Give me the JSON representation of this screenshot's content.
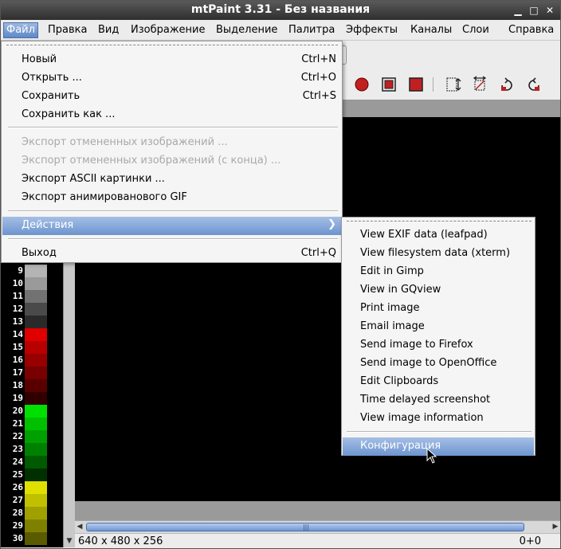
{
  "window": {
    "title": "mtPaint 3.31 - Без названия"
  },
  "menubar": [
    {
      "label": "Файл"
    },
    {
      "label": "Правка"
    },
    {
      "label": "Вид"
    },
    {
      "label": "Изображение"
    },
    {
      "label": "Выделение"
    },
    {
      "label": "Палитра"
    },
    {
      "label": "Эффекты"
    },
    {
      "label": "Каналы"
    },
    {
      "label": "Слои"
    },
    {
      "label": "Справка"
    }
  ],
  "file_menu": {
    "items": [
      {
        "label": "Новый",
        "accel": "Ctrl+N"
      },
      {
        "label": "Открыть ...",
        "accel": "Ctrl+O"
      },
      {
        "label": "Сохранить",
        "accel": "Ctrl+S"
      },
      {
        "label": "Сохранить как ..."
      },
      {
        "label": "Экспорт отмененных изображений ..."
      },
      {
        "label": "Экспорт отмененных изображений (с конца) ..."
      },
      {
        "label": "Экспорт ASCII картинки ..."
      },
      {
        "label": "Экспорт анимированового GIF"
      },
      {
        "label": "Действия"
      },
      {
        "label": "Выход",
        "accel": "Ctrl+Q"
      }
    ]
  },
  "actions_submenu": {
    "items": [
      {
        "label": "View EXIF data (leafpad)"
      },
      {
        "label": "View filesystem data (xterm)"
      },
      {
        "label": "Edit in Gimp"
      },
      {
        "label": "View in GQview"
      },
      {
        "label": "Print image"
      },
      {
        "label": "Email image"
      },
      {
        "label": "Send image to Firefox"
      },
      {
        "label": "Send image to OpenOffice"
      },
      {
        "label": "Edit Clipboards"
      },
      {
        "label": "Time delayed screenshot"
      },
      {
        "label": "View image information"
      },
      {
        "label": "Конфигурация"
      }
    ]
  },
  "palette": [
    {
      "index": "9",
      "color": "#b4b4b4"
    },
    {
      "index": "10",
      "color": "#9a9a9a"
    },
    {
      "index": "11",
      "color": "#727272"
    },
    {
      "index": "12",
      "color": "#4a4a4a"
    },
    {
      "index": "13",
      "color": "#2a2a2a"
    },
    {
      "index": "14",
      "color": "#e00000"
    },
    {
      "index": "15",
      "color": "#b80000"
    },
    {
      "index": "16",
      "color": "#980000"
    },
    {
      "index": "17",
      "color": "#780000"
    },
    {
      "index": "18",
      "color": "#580000"
    },
    {
      "index": "19",
      "color": "#300000"
    },
    {
      "index": "20",
      "color": "#00e000"
    },
    {
      "index": "21",
      "color": "#00c000"
    },
    {
      "index": "22",
      "color": "#00a000"
    },
    {
      "index": "23",
      "color": "#008000"
    },
    {
      "index": "24",
      "color": "#005a00"
    },
    {
      "index": "25",
      "color": "#003000"
    },
    {
      "index": "26",
      "color": "#e0e000"
    },
    {
      "index": "27",
      "color": "#c0c000"
    },
    {
      "index": "28",
      "color": "#a0a000"
    },
    {
      "index": "29",
      "color": "#808000"
    },
    {
      "index": "30",
      "color": "#5a5a00"
    }
  ],
  "status": {
    "image_size": "640 x 480 x 256",
    "coords": "0+0"
  },
  "colors": {
    "highlight": "#6d94cf",
    "title_bar": "#3a3a3a",
    "canvas": "#000000"
  }
}
